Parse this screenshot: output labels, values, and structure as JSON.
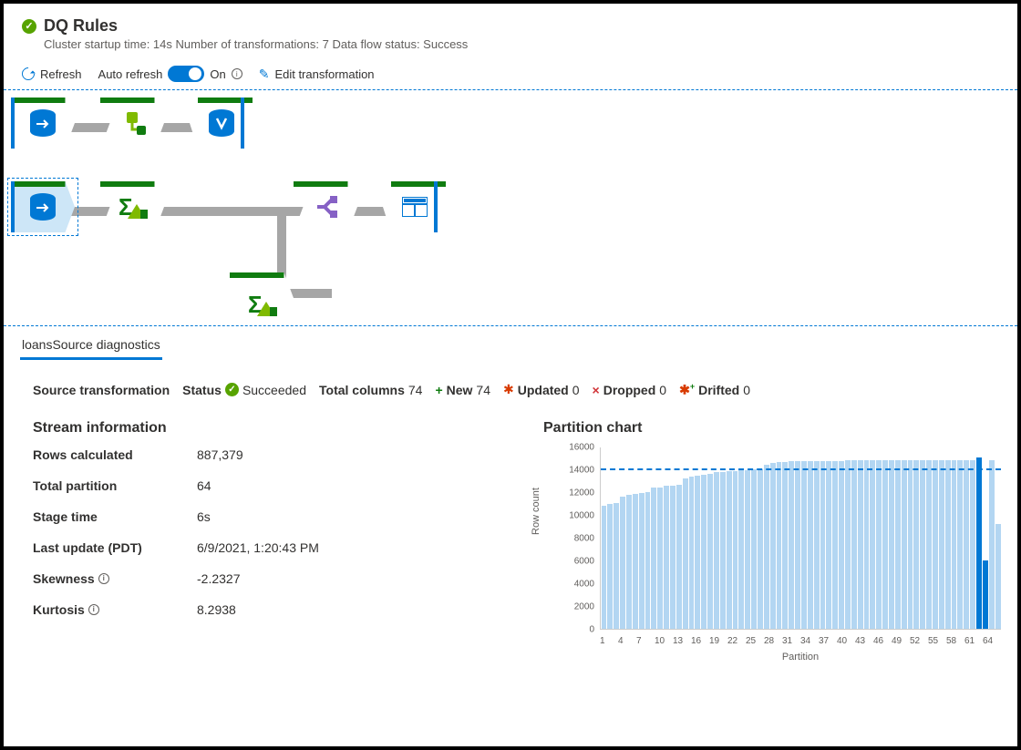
{
  "header": {
    "title": "DQ Rules",
    "subtitle": "Cluster startup time: 14s   Number of transformations: 7   Data flow status: Success"
  },
  "toolbar": {
    "refresh": "Refresh",
    "auto_refresh": "Auto refresh",
    "toggle_state": "On",
    "edit": "Edit transformation"
  },
  "graph": {
    "row1": [
      "source",
      "transform",
      "sink"
    ],
    "row2": [
      "source",
      "aggregate",
      "split",
      "sink"
    ],
    "row3": [
      "aggregate"
    ]
  },
  "panel": {
    "tab": "loansSource diagnostics",
    "status_row": {
      "type": "Source transformation",
      "status_label": "Status",
      "status_value": "Succeeded",
      "total_label": "Total columns",
      "total_value": "74",
      "new_label": "New",
      "new_value": "74",
      "updated_label": "Updated",
      "updated_value": "0",
      "dropped_label": "Dropped",
      "dropped_value": "0",
      "drifted_label": "Drifted",
      "drifted_value": "0"
    },
    "stream": {
      "title": "Stream information",
      "rows_label": "Rows calculated",
      "rows_value": "887,379",
      "part_label": "Total partition",
      "part_value": "64",
      "stage_label": "Stage time",
      "stage_value": "6s",
      "update_label": "Last update (PDT)",
      "update_value": "6/9/2021, 1:20:43 PM",
      "skew_label": "Skewness",
      "skew_value": "-2.2327",
      "kurt_label": "Kurtosis",
      "kurt_value": "8.2938"
    },
    "chart": {
      "title": "Partition chart",
      "ylabel": "Row count",
      "xlabel": "Partition"
    }
  },
  "chart_data": {
    "type": "bar",
    "title": "Partition chart",
    "xlabel": "Partition",
    "ylabel": "Row count",
    "ylim": [
      0,
      16000
    ],
    "yticks": [
      0,
      2000,
      4000,
      6000,
      8000,
      10000,
      12000,
      14000,
      16000
    ],
    "xticks": [
      1,
      4,
      7,
      10,
      13,
      16,
      19,
      22,
      25,
      28,
      31,
      34,
      37,
      40,
      43,
      46,
      49,
      52,
      55,
      58,
      61,
      64
    ],
    "mean_line": 13865,
    "categories": [
      1,
      2,
      3,
      4,
      5,
      6,
      7,
      8,
      9,
      10,
      11,
      12,
      13,
      14,
      15,
      16,
      17,
      18,
      19,
      20,
      21,
      22,
      23,
      24,
      25,
      26,
      27,
      28,
      29,
      30,
      31,
      32,
      33,
      34,
      35,
      36,
      37,
      38,
      39,
      40,
      41,
      42,
      43,
      44,
      45,
      46,
      47,
      48,
      49,
      50,
      51,
      52,
      53,
      54,
      55,
      56,
      57,
      58,
      59,
      60,
      61,
      62,
      63,
      64
    ],
    "values": [
      10800,
      10900,
      11000,
      11600,
      11700,
      11800,
      11900,
      12000,
      12400,
      12400,
      12500,
      12500,
      12600,
      13200,
      13300,
      13400,
      13500,
      13600,
      13700,
      13700,
      13800,
      13800,
      13900,
      13900,
      14000,
      14000,
      14400,
      14500,
      14600,
      14600,
      14700,
      14700,
      14700,
      14700,
      14700,
      14700,
      14700,
      14700,
      14700,
      14800,
      14800,
      14800,
      14800,
      14800,
      14800,
      14800,
      14800,
      14800,
      14800,
      14800,
      14800,
      14800,
      14800,
      14800,
      14800,
      14800,
      14800,
      14800,
      14800,
      14800,
      15000,
      6000,
      14800,
      9200
    ],
    "highlight_indices": [
      60,
      61
    ]
  }
}
